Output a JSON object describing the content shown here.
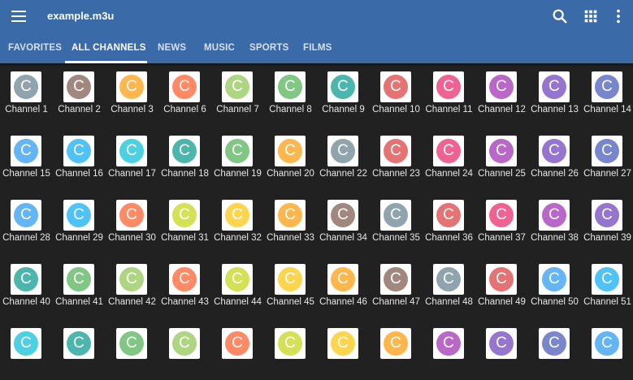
{
  "appbar": {
    "title": "example.m3u",
    "menu_icon": "menu-icon",
    "search_icon": "search-icon",
    "grid_icon": "grid-icon",
    "more_icon": "more-vert-icon"
  },
  "tabs": [
    {
      "label": "FAVORITES"
    },
    {
      "label": "ALL CHANNELS",
      "active": true
    },
    {
      "label": "NEWS"
    },
    {
      "label": "MUSIC"
    },
    {
      "label": "SPORTS"
    },
    {
      "label": "FILMS"
    }
  ],
  "colors": {
    "appbar": "#3b6aa8",
    "background": "#212121"
  },
  "channels": [
    {
      "name": "Channel 1",
      "letter": "C",
      "color": "#90a4ae"
    },
    {
      "name": "Channel 2",
      "letter": "C",
      "color": "#a1887f"
    },
    {
      "name": "Channel 3",
      "letter": "C",
      "color": "#ffb74d"
    },
    {
      "name": "Channel 6",
      "letter": "C",
      "color": "#ff8a65"
    },
    {
      "name": "Channel 7",
      "letter": "C",
      "color": "#aed581"
    },
    {
      "name": "Channel 8",
      "letter": "C",
      "color": "#81c784"
    },
    {
      "name": "Channel 9",
      "letter": "C",
      "color": "#4db6ac"
    },
    {
      "name": "Channel 10",
      "letter": "C",
      "color": "#e57373"
    },
    {
      "name": "Channel 11",
      "letter": "C",
      "color": "#f06292"
    },
    {
      "name": "Channel 12",
      "letter": "C",
      "color": "#ba68c8"
    },
    {
      "name": "Channel 13",
      "letter": "C",
      "color": "#9575cd"
    },
    {
      "name": "Channel 14",
      "letter": "C",
      "color": "#7986cb"
    },
    {
      "name": "Channel 15",
      "letter": "C",
      "color": "#64b5f6"
    },
    {
      "name": "Channel 16",
      "letter": "C",
      "color": "#4fc3f7"
    },
    {
      "name": "Channel 17",
      "letter": "C",
      "color": "#4dd0e1"
    },
    {
      "name": "Channel 18",
      "letter": "C",
      "color": "#4db6ac"
    },
    {
      "name": "Channel 19",
      "letter": "C",
      "color": "#81c784"
    },
    {
      "name": "Channel 20",
      "letter": "C",
      "color": "#ffb74d"
    },
    {
      "name": "Channel 22",
      "letter": "C",
      "color": "#90a4ae"
    },
    {
      "name": "Channel 23",
      "letter": "C",
      "color": "#e57373"
    },
    {
      "name": "Channel 24",
      "letter": "C",
      "color": "#f06292"
    },
    {
      "name": "Channel 25",
      "letter": "C",
      "color": "#ba68c8"
    },
    {
      "name": "Channel 26",
      "letter": "C",
      "color": "#9575cd"
    },
    {
      "name": "Channel 27",
      "letter": "C",
      "color": "#7986cb"
    },
    {
      "name": "Channel 28",
      "letter": "C",
      "color": "#64b5f6"
    },
    {
      "name": "Channel 29",
      "letter": "C",
      "color": "#4fc3f7"
    },
    {
      "name": "Channel 30",
      "letter": "C",
      "color": "#ff8a65"
    },
    {
      "name": "Channel 31",
      "letter": "C",
      "color": "#d4e157"
    },
    {
      "name": "Channel 32",
      "letter": "C",
      "color": "#ffd54f"
    },
    {
      "name": "Channel 33",
      "letter": "C",
      "color": "#ffb74d"
    },
    {
      "name": "Channel 34",
      "letter": "C",
      "color": "#a1887f"
    },
    {
      "name": "Channel 35",
      "letter": "C",
      "color": "#90a4ae"
    },
    {
      "name": "Channel 36",
      "letter": "C",
      "color": "#e57373"
    },
    {
      "name": "Channel 37",
      "letter": "C",
      "color": "#f06292"
    },
    {
      "name": "Channel 38",
      "letter": "C",
      "color": "#ba68c8"
    },
    {
      "name": "Channel 39",
      "letter": "C",
      "color": "#9575cd"
    },
    {
      "name": "Channel 40",
      "letter": "C",
      "color": "#4db6ac"
    },
    {
      "name": "Channel 41",
      "letter": "C",
      "color": "#81c784"
    },
    {
      "name": "Channel 42",
      "letter": "C",
      "color": "#aed581"
    },
    {
      "name": "Channel 43",
      "letter": "C",
      "color": "#ff8a65"
    },
    {
      "name": "Channel 44",
      "letter": "C",
      "color": "#d4e157"
    },
    {
      "name": "Channel 45",
      "letter": "C",
      "color": "#ffd54f"
    },
    {
      "name": "Channel 46",
      "letter": "C",
      "color": "#ffb74d"
    },
    {
      "name": "Channel 47",
      "letter": "C",
      "color": "#a1887f"
    },
    {
      "name": "Channel 48",
      "letter": "C",
      "color": "#90a4ae"
    },
    {
      "name": "Channel 49",
      "letter": "C",
      "color": "#e57373"
    },
    {
      "name": "Channel 50",
      "letter": "C",
      "color": "#64b5f6"
    },
    {
      "name": "Channel 51",
      "letter": "C",
      "color": "#4fc3f7"
    },
    {
      "name": "",
      "letter": "C",
      "color": "#4dd0e1"
    },
    {
      "name": "",
      "letter": "C",
      "color": "#4db6ac"
    },
    {
      "name": "",
      "letter": "C",
      "color": "#81c784"
    },
    {
      "name": "",
      "letter": "C",
      "color": "#aed581"
    },
    {
      "name": "",
      "letter": "C",
      "color": "#ff8a65"
    },
    {
      "name": "",
      "letter": "C",
      "color": "#d4e157"
    },
    {
      "name": "",
      "letter": "C",
      "color": "#ffd54f"
    },
    {
      "name": "",
      "letter": "C",
      "color": "#ffb74d"
    },
    {
      "name": "",
      "letter": "C",
      "color": "#ba68c8"
    },
    {
      "name": "",
      "letter": "C",
      "color": "#9575cd"
    },
    {
      "name": "",
      "letter": "C",
      "color": "#7986cb"
    },
    {
      "name": "",
      "letter": "C",
      "color": "#64b5f6"
    }
  ]
}
